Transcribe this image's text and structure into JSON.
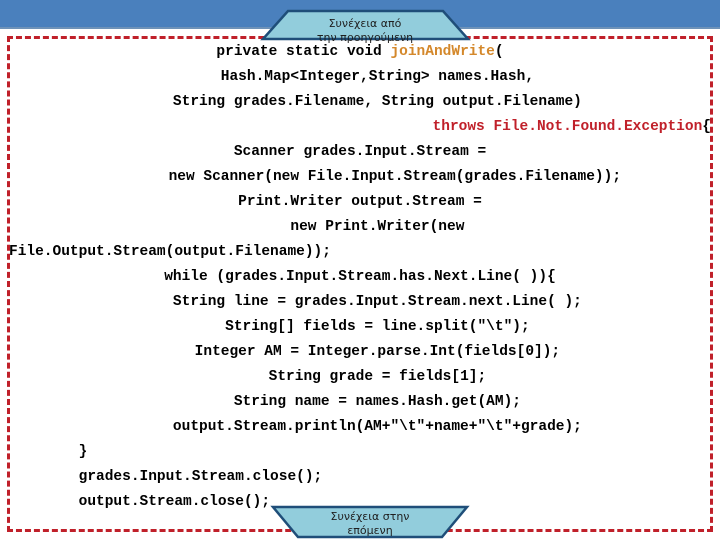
{
  "slide": {
    "background_color": "#FFFFFF",
    "band_color": "#4A80BD",
    "frame_color": "#C0202A",
    "callout_fill": "#92CDDC",
    "callout_stroke": "#1F4E79",
    "method_color": "#D4882B",
    "throws_color": "#C0202A"
  },
  "callouts": {
    "top": {
      "text": "Συνέχεια από\nτην προηγούμενη"
    },
    "bottom": {
      "text": "Συνέχεια στην\nεπόμενη"
    }
  },
  "code": {
    "lines": [
      {
        "align": "center",
        "segments": [
          {
            "text": "private static void ",
            "color": "plain"
          },
          {
            "text": "joinAndWrite",
            "color": "method"
          },
          {
            "text": "(",
            "color": "plain"
          }
        ]
      },
      {
        "align": "center",
        "segments": [
          {
            "text": "    Hash.Map<Integer,String> names.Hash,",
            "color": "plain"
          }
        ]
      },
      {
        "align": "center",
        "segments": [
          {
            "text": "    String grades.Filename, String output.Filename)",
            "color": "plain"
          }
        ]
      },
      {
        "align": "right",
        "segments": [
          {
            "text": "throws File.Not.Found.Exception",
            "color": "throws"
          },
          {
            "text": "{",
            "color": "plain"
          }
        ]
      },
      {
        "align": "center",
        "segments": [
          {
            "text": "Scanner grades.Input.Stream =",
            "color": "plain"
          }
        ]
      },
      {
        "align": "center",
        "segments": [
          {
            "text": "        new Scanner(new File.Input.Stream(grades.Filename));",
            "color": "plain"
          }
        ]
      },
      {
        "align": "center",
        "segments": [
          {
            "text": "Print.Writer output.Stream =",
            "color": "plain"
          }
        ]
      },
      {
        "align": "center",
        "segments": [
          {
            "text": "    new Print.Writer(new",
            "color": "plain"
          }
        ]
      },
      {
        "align": "left",
        "segments": [
          {
            "text": "File.Output.Stream(output.Filename));",
            "color": "plain"
          }
        ]
      },
      {
        "align": "center",
        "segments": [
          {
            "text": "while (grades.Input.Stream.has.Next.Line( )){",
            "color": "plain"
          }
        ]
      },
      {
        "align": "center",
        "segments": [
          {
            "text": "    String line = grades.Input.Stream.next.Line( );",
            "color": "plain"
          }
        ]
      },
      {
        "align": "center",
        "segments": [
          {
            "text": "    String[] fields = line.split(\"\\t\");",
            "color": "plain"
          }
        ]
      },
      {
        "align": "center",
        "segments": [
          {
            "text": "    Integer AM = Integer.parse.Int(fields[0]);",
            "color": "plain"
          }
        ]
      },
      {
        "align": "center",
        "segments": [
          {
            "text": "    String grade = fields[1];",
            "color": "plain"
          }
        ]
      },
      {
        "align": "center",
        "segments": [
          {
            "text": "    String name = names.Hash.get(AM);",
            "color": "plain"
          }
        ]
      },
      {
        "align": "center",
        "segments": [
          {
            "text": "    output.Stream.println(AM+\"\\t\"+name+\"\\t\"+grade);",
            "color": "plain"
          }
        ]
      },
      {
        "align": "left",
        "segments": [
          {
            "text": "        }",
            "color": "plain"
          }
        ]
      },
      {
        "align": "left",
        "segments": [
          {
            "text": "        grades.Input.Stream.close();",
            "color": "plain"
          }
        ]
      },
      {
        "align": "left",
        "segments": [
          {
            "text": "        output.Stream.close();",
            "color": "plain"
          }
        ]
      }
    ]
  }
}
